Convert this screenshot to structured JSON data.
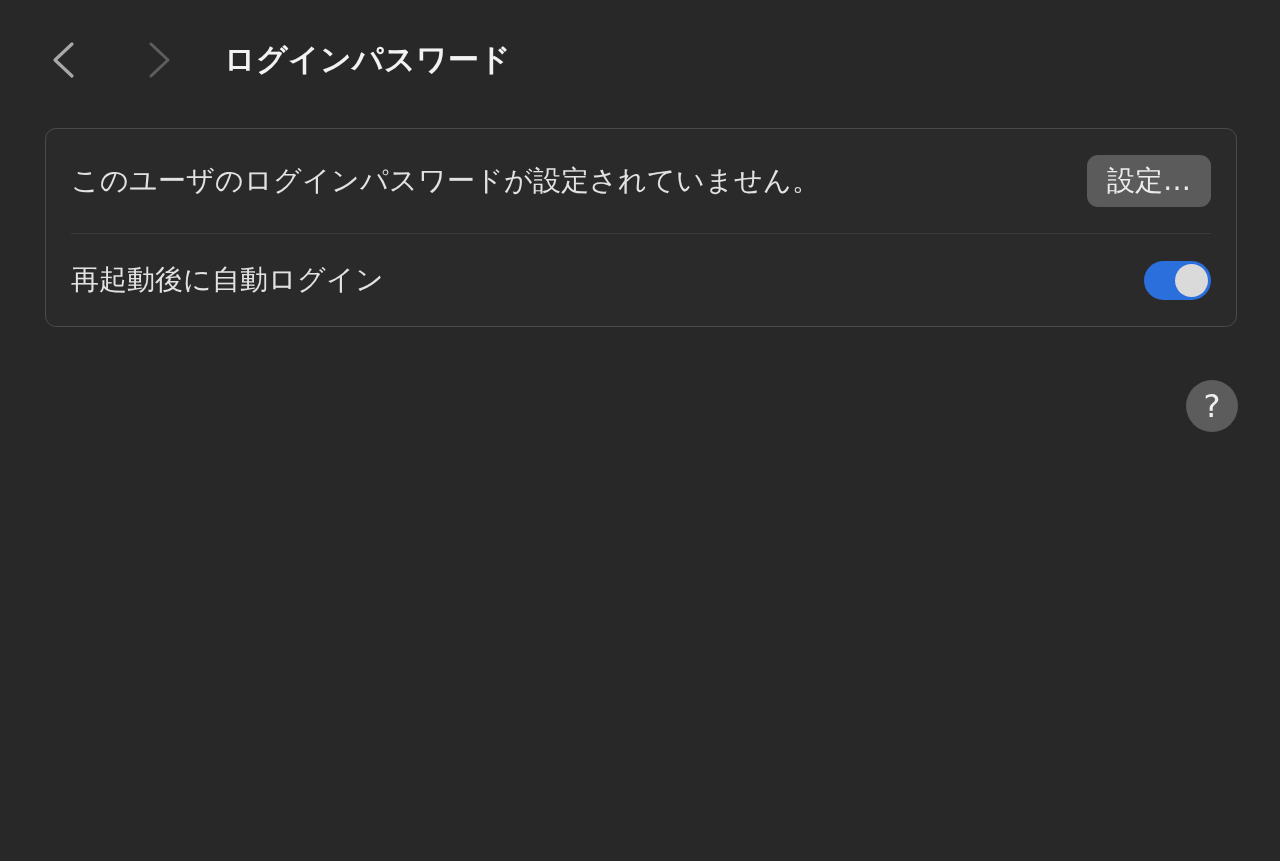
{
  "toolbar": {
    "back_button": {
      "disabled": false
    },
    "forward_button": {
      "disabled": true
    },
    "title": "ログインパスワード"
  },
  "settings": [
    {
      "kind": "button-row",
      "label": "このユーザのログインパスワードが設定されていません。",
      "button": "設定…"
    },
    {
      "kind": "toggle-row",
      "label": "再起動後に自動ログイン",
      "on": true
    }
  ],
  "help_button": {
    "label": "?"
  }
}
